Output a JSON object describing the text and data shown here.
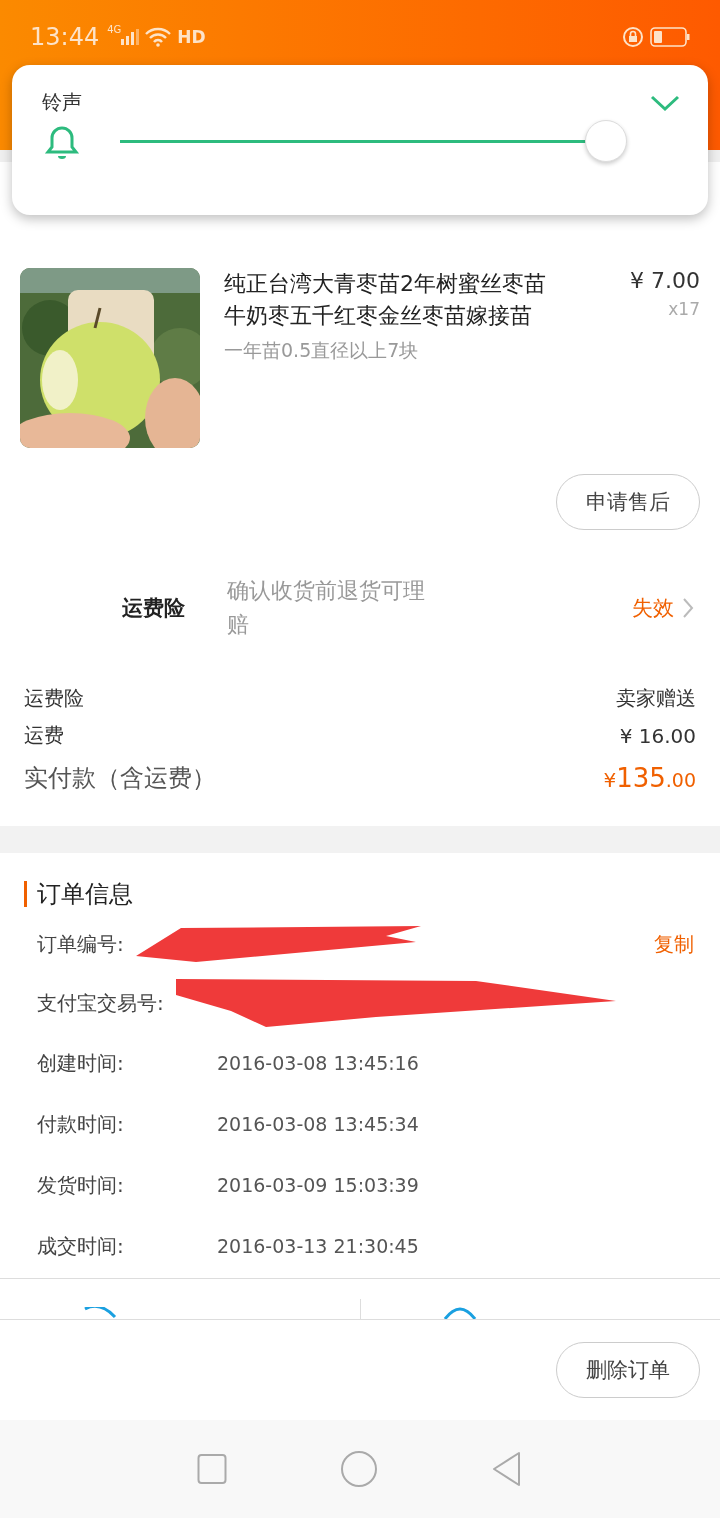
{
  "status_bar": {
    "time": "13:44",
    "network": "4G",
    "hd": "HD"
  },
  "volume_panel": {
    "title": "铃声",
    "level": 0.96
  },
  "product": {
    "title": "纯正台湾大青枣苗2年树蜜丝枣苗牛奶枣五千红枣金丝枣苗嫁接苗",
    "spec": "一年苗0.5直径以上7块",
    "price": "¥ 7.00",
    "quantity": "x17",
    "after_sale_button": "申请售后"
  },
  "insurance": {
    "label": "运费险",
    "description": "确认收货前退货可理赔",
    "status": "失效"
  },
  "fees": [
    {
      "label": "运费险",
      "value": "卖家赠送"
    },
    {
      "label": "运费",
      "value": "¥ 16.00"
    }
  ],
  "total": {
    "label": "实付款（含运费）",
    "currency": "¥",
    "amount": "135",
    "cents": ".00"
  },
  "order_info": {
    "title": "订单信息",
    "copy_button": "复制",
    "rows": [
      {
        "label": "订单编号:",
        "kind": "redacted"
      },
      {
        "label": "支付宝交易号:",
        "kind": "redacted"
      },
      {
        "label": "创建时间:",
        "value": "2016-03-08 13:45:16",
        "kind": "text"
      },
      {
        "label": "付款时间:",
        "value": "2016-03-08 13:45:34",
        "kind": "text"
      },
      {
        "label": "发货时间:",
        "value": "2016-03-09 15:03:39",
        "kind": "text"
      },
      {
        "label": "成交时间:",
        "value": "2016-03-13 21:30:45",
        "kind": "text"
      }
    ]
  },
  "footer": {
    "delete_button": "删除订单"
  }
}
